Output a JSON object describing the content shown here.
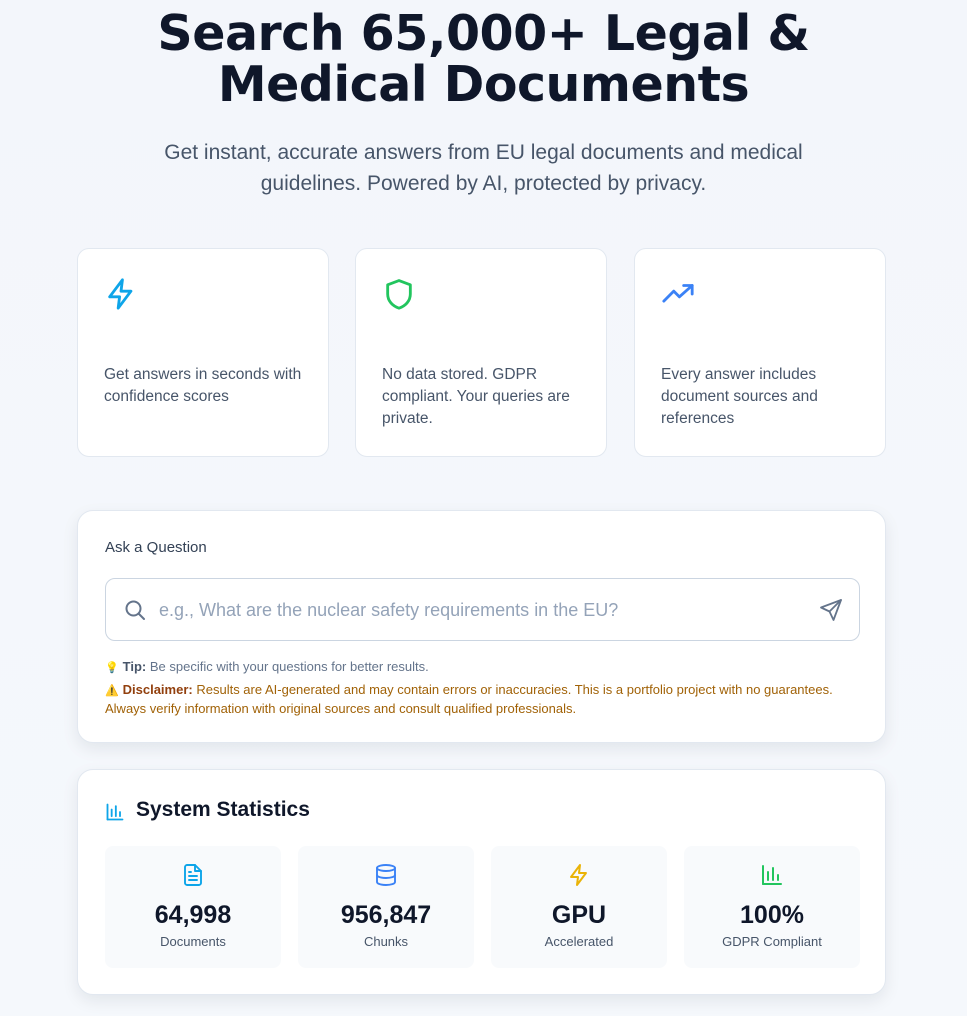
{
  "hero": {
    "title_line1": "Search 65,000+ Legal &",
    "title_line2": "Medical Documents",
    "subtitle": "Get instant, accurate answers from EU legal documents and medical guidelines. Powered by AI, protected by privacy."
  },
  "features": [
    {
      "icon": "lightning-icon",
      "text": "Get answers in seconds with confidence scores"
    },
    {
      "icon": "shield-icon",
      "text": "No data stored. GDPR compliant. Your queries are private."
    },
    {
      "icon": "trending-up-icon",
      "text": "Every answer includes document sources and references"
    }
  ],
  "ask": {
    "label": "Ask a Question",
    "input_value": "",
    "placeholder": "e.g., What are the nuclear safety requirements in the EU?",
    "tip_emoji": "💡",
    "tip_label": "Tip:",
    "tip_text": "Be specific with your questions for better results.",
    "disclaimer_emoji": "⚠️",
    "disclaimer_label": "Disclaimer:",
    "disclaimer_text": "Results are AI-generated and may contain errors or inaccuracies. This is a portfolio project with no guarantees. Always verify information with original sources and consult qualified professionals."
  },
  "stats": {
    "title": "System Statistics",
    "items": [
      {
        "icon": "document-icon",
        "value": "64,998",
        "label": "Documents"
      },
      {
        "icon": "database-icon",
        "value": "956,847",
        "label": "Chunks"
      },
      {
        "icon": "lightning-icon",
        "value": "GPU",
        "label": "Accelerated"
      },
      {
        "icon": "bar-chart-icon",
        "value": "100%",
        "label": "GDPR Compliant"
      }
    ]
  },
  "colors": {
    "lightning_blue": "#0ea5e9",
    "shield_green": "#22c55e",
    "trend_blue": "#3b82f6",
    "gpu_amber": "#eab308",
    "disclaimer": "#a16207"
  }
}
